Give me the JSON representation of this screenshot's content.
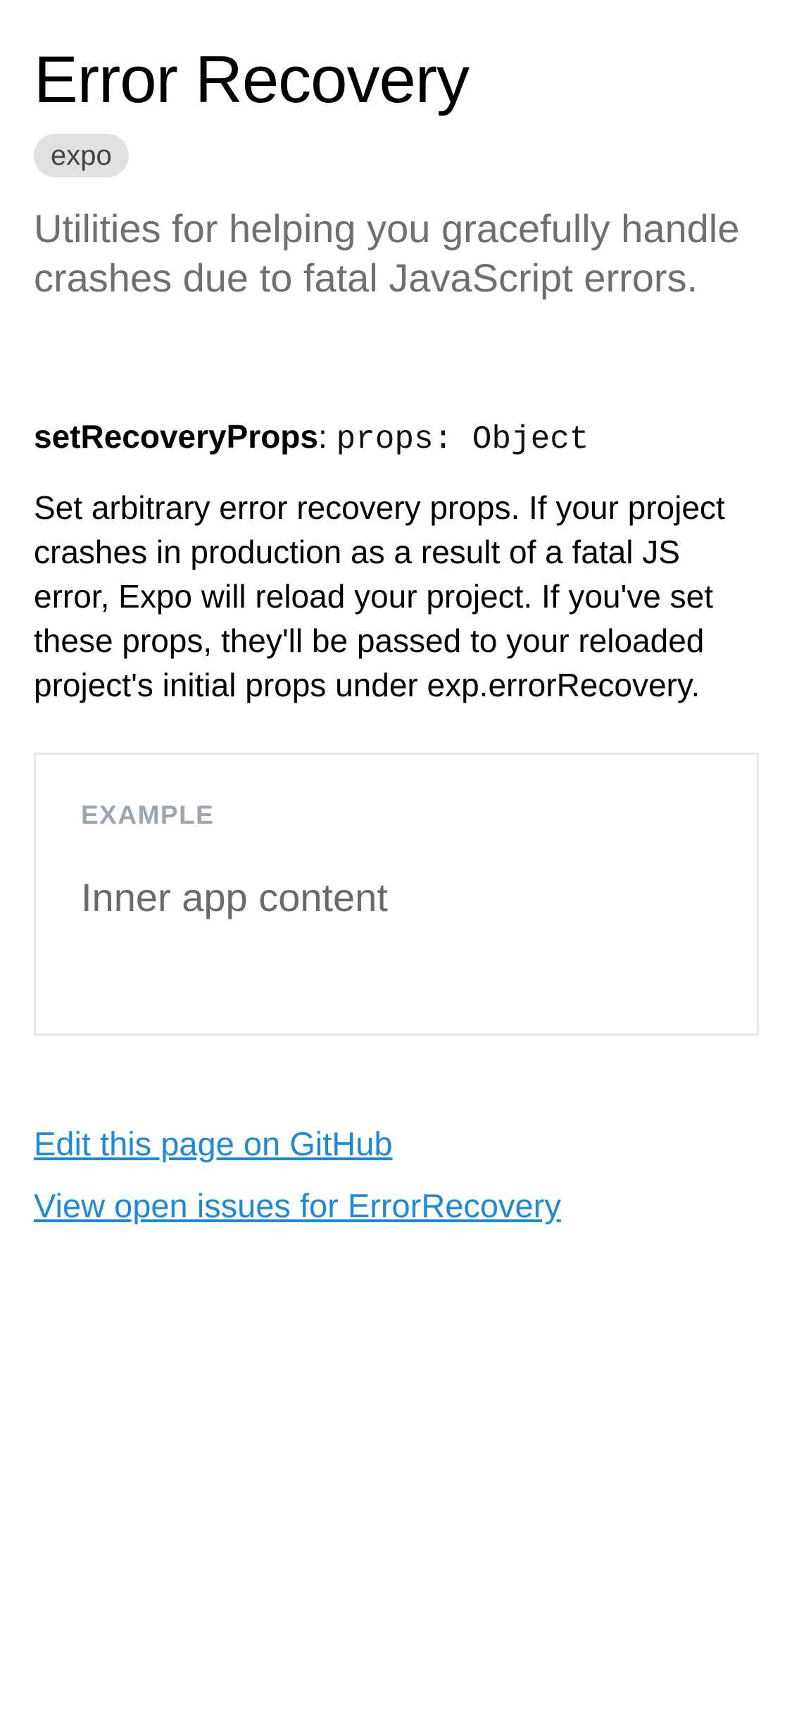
{
  "header": {
    "title": "Error Recovery",
    "badge": "expo",
    "subtitle": "Utilities for helping you gracefully handle crashes due to fatal JavaScript errors."
  },
  "method": {
    "name": "setRecoveryProps",
    "separator": ": ",
    "signature": "props: Object",
    "description": "Set arbitrary error recovery props. If your project crashes in production as a result of a fatal JS error, Expo will reload your project. If you've set these props, they'll be passed to your reloaded project's initial props under exp.errorRecovery."
  },
  "example": {
    "label": "EXAMPLE",
    "content": "Inner app content"
  },
  "links": {
    "edit_github": "Edit this page on GitHub",
    "view_issues": "View open issues for ErrorRecovery"
  },
  "colors": {
    "link": "#2089d4",
    "badge_bg": "#e1e1e1",
    "subtitle": "#6f6f6f",
    "example_label": "#9ba6b0",
    "example_border": "#e6eaee"
  }
}
